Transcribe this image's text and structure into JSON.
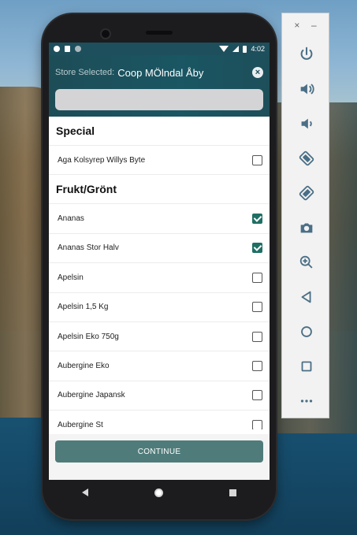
{
  "statusbar": {
    "time": "4:02"
  },
  "header": {
    "store_label": "Store Selected:",
    "store_name": "Coop MÖlndal Åby",
    "close_icon": "×",
    "search_placeholder": ""
  },
  "sections": [
    {
      "title": "Special",
      "items": [
        {
          "label": "Aga Kolsyrep Willys Byte",
          "checked": false
        }
      ]
    },
    {
      "title": "Frukt/Grönt",
      "items": [
        {
          "label": "Ananas",
          "checked": true
        },
        {
          "label": "Ananas Stor Halv",
          "checked": true
        },
        {
          "label": "Apelsin",
          "checked": false
        },
        {
          "label": "Apelsin 1,5 Kg",
          "checked": false
        },
        {
          "label": "Apelsin Eko 750g",
          "checked": false
        },
        {
          "label": "Aubergine Eko",
          "checked": false
        },
        {
          "label": "Aubergine Japansk",
          "checked": false
        },
        {
          "label": "Aubergine St",
          "checked": false
        }
      ]
    }
  ],
  "footer": {
    "continue_label": "CONTINUE"
  },
  "emulator_toolbar": {
    "close": "×",
    "minimize": "–",
    "buttons": [
      "power-icon",
      "volume-up-icon",
      "volume-down-icon",
      "rotate-left-icon",
      "rotate-right-icon",
      "camera-icon",
      "zoom-icon",
      "back-icon",
      "home-icon",
      "overview-icon",
      "more-icon"
    ]
  },
  "colors": {
    "accent": "#1f6f64",
    "header": "#1d4d57",
    "continue": "#4f7c7a"
  }
}
